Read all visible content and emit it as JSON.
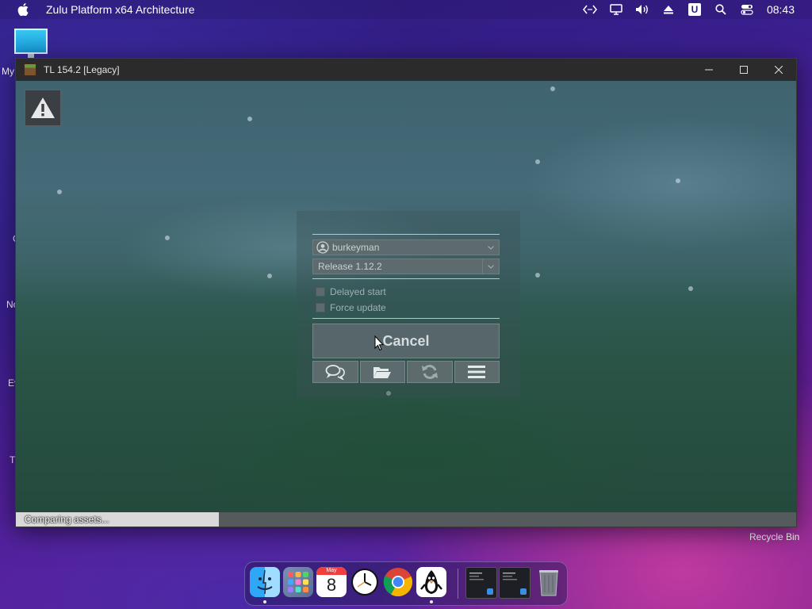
{
  "menubar": {
    "app_name": "Zulu Platform x64 Architecture",
    "clock": "08:43",
    "u_badge": "U"
  },
  "desktop": {
    "labels": [
      "My",
      "C",
      "No",
      "Ev",
      "T"
    ],
    "recycle_bin": "Recycle Bin"
  },
  "window": {
    "title": "TL 154.2 [Legacy]"
  },
  "login": {
    "username": "burkeyman",
    "version": "Release 1.12.2",
    "delayed_start": "Delayed start",
    "force_update": "Force update",
    "cancel": "Cancel"
  },
  "status": {
    "text": "Comparing assets...",
    "progress": 0.26
  },
  "dock": {
    "calendar_month": "May",
    "calendar_day": "8"
  },
  "colors": {
    "accent_panel": "#5d6a6e",
    "progress_fill": "#d9d9d9"
  }
}
